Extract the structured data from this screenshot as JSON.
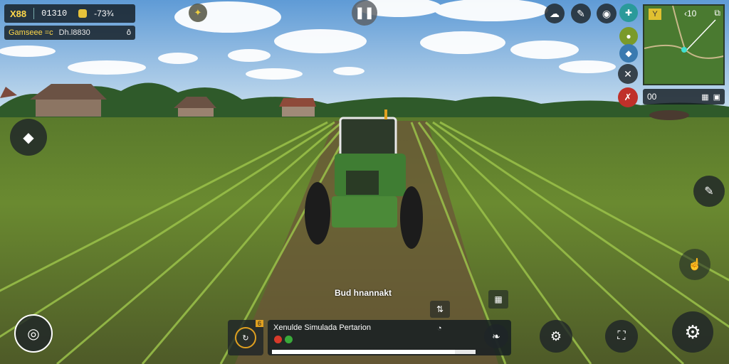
{
  "hud": {
    "money_label": "X88",
    "time_text": "01310",
    "coin_value": "-73¾",
    "status_left": "Gamseee =c",
    "status_mid": "Dh.l8830",
    "status_right": "ô"
  },
  "minimap": {
    "top_left": "Y",
    "top_value": "‹10",
    "bottom_value": "00"
  },
  "center_label": "Bud hnannakt",
  "task_panel": {
    "badge": "6",
    "title": "Xenulde Simulada Pertarion",
    "progress": 0.9
  },
  "icons": {
    "settings": "gear-icon",
    "pause": "pause-icon"
  }
}
